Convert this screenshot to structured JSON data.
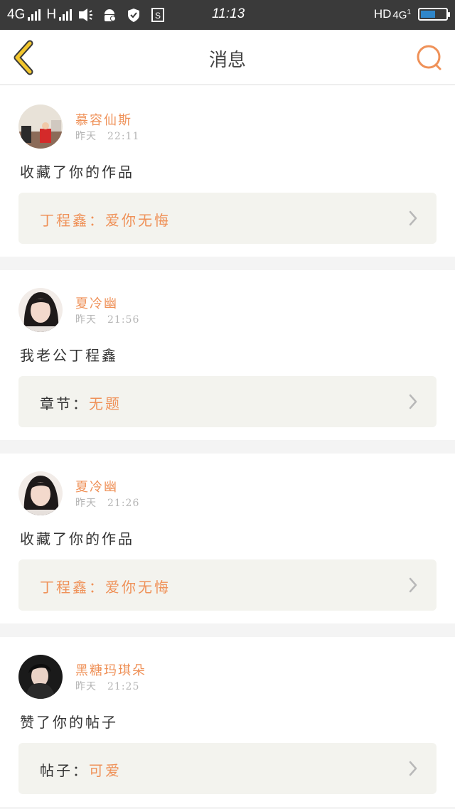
{
  "status_bar": {
    "network1": "4G",
    "network2": "H",
    "time": "11:13",
    "hd": "HD",
    "fourg": "4G",
    "fourg_sub": "1"
  },
  "header": {
    "title": "消息",
    "back_icon": "chevron-left-icon",
    "search_icon": "search-icon"
  },
  "colors": {
    "accent": "#ef9158",
    "back_arrow": "#f2c62d",
    "ref_bg": "#f3f3ee",
    "divider": "#f4f4f4"
  },
  "messages": [
    {
      "user": "慕容仙斯",
      "time": "昨天　22:11",
      "action": "收藏了你的作品",
      "ref_prefix": "丁程鑫：",
      "ref_value": "爱你无悔",
      "prefix_accent": true
    },
    {
      "user": "夏冷幽",
      "time": "昨天　21:56",
      "action": "我老公丁程鑫",
      "ref_prefix": "章节：",
      "ref_value": "无题",
      "prefix_accent": false
    },
    {
      "user": "夏冷幽",
      "time": "昨天　21:26",
      "action": "收藏了你的作品",
      "ref_prefix": "丁程鑫：",
      "ref_value": "爱你无悔",
      "prefix_accent": true
    },
    {
      "user": "黑糖玛琪朵",
      "time": "昨天　21:25",
      "action": "赞了你的帖子",
      "ref_prefix": "帖子：",
      "ref_value": "可爱",
      "prefix_accent": false
    }
  ]
}
